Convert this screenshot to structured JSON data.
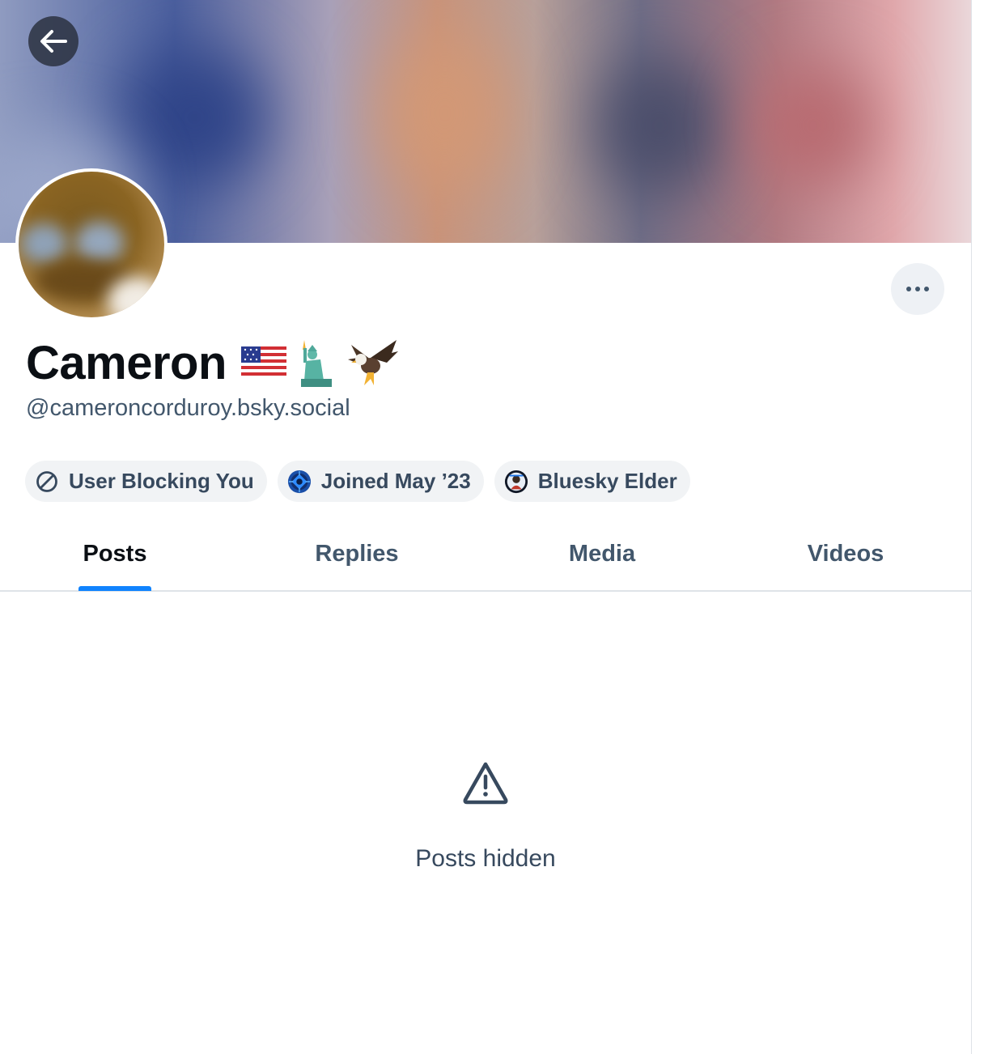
{
  "profile": {
    "display_name": "Cameron",
    "name_emojis": [
      "🇺🇸",
      "🗽",
      "🦅"
    ],
    "handle": "@cameroncorduroy.bsky.social"
  },
  "header": {
    "back_icon": "arrow-left-icon",
    "more_icon": "ellipsis-icon"
  },
  "badges": [
    {
      "label": "User Blocking You",
      "icon": "block-icon"
    },
    {
      "label": "Joined May ’23",
      "icon": "starter-badge-icon"
    },
    {
      "label": "Bluesky Elder",
      "icon": "elder-badge-icon"
    }
  ],
  "tabs": [
    {
      "label": "Posts",
      "active": true
    },
    {
      "label": "Replies",
      "active": false
    },
    {
      "label": "Media",
      "active": false
    },
    {
      "label": "Videos",
      "active": false
    }
  ],
  "empty_state": {
    "icon": "warning-triangle-icon",
    "message": "Posts hidden"
  },
  "colors": {
    "accent": "#1083fe",
    "text_primary": "#0b0f14",
    "text_secondary": "#42576c",
    "badge_bg": "#f1f3f5"
  }
}
